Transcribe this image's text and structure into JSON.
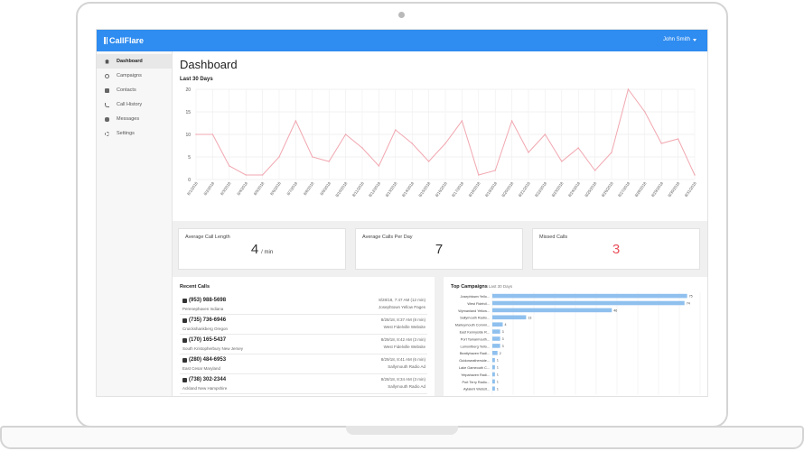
{
  "app": {
    "brand": "CallFlare",
    "user": "John Smith"
  },
  "sidebar": {
    "items": [
      {
        "label": "Dashboard",
        "icon": "home-icon",
        "active": true
      },
      {
        "label": "Campaigns",
        "icon": "campaigns-icon"
      },
      {
        "label": "Contacts",
        "icon": "contacts-icon"
      },
      {
        "label": "Call History",
        "icon": "phone-icon"
      },
      {
        "label": "Messages",
        "icon": "messages-icon"
      },
      {
        "label": "Settings",
        "icon": "gear-icon"
      }
    ]
  },
  "page": {
    "title": "Dashboard"
  },
  "stats": [
    {
      "label": "Average Call Length",
      "value": "4",
      "unit": "/ min"
    },
    {
      "label": "Average Calls Per Day",
      "value": "7",
      "unit": ""
    },
    {
      "label": "Missed Calls",
      "value": "3",
      "unit": ""
    }
  ],
  "recent_calls": {
    "title": "Recent Calls",
    "rows": [
      {
        "number": "(953) 988-5698",
        "location": "Perenephaven Indiana",
        "date": "8/28/18, 7:47 AM (12 min)",
        "source": "Josephtown Yellow Pages"
      },
      {
        "number": "(735) 736-6946",
        "location": "Cruickshankberg Oregon",
        "date": "8/28/18, 8:37 AM (8 min)",
        "source": "West Fidelville Website"
      },
      {
        "number": "(170) 165-5437",
        "location": "South Kristopherbury New Jersey",
        "date": "8/29/18, 8:42 AM (3 min)",
        "source": "West Fidelville Website"
      },
      {
        "number": "(280) 484-6953",
        "location": "East Cesar Maryland",
        "date": "8/29/18, 8:41 AM (6 min)",
        "source": "Sallymouth Radio Ad"
      },
      {
        "number": "(738) 302-2344",
        "location": "Ackland New Hampshire",
        "date": "8/28/18, 8:34 AM (3 min)",
        "source": "Sallymouth Radio Ad"
      }
    ]
  },
  "top_campaigns": {
    "title": "Top Campaigns",
    "subtitle": "Last 30 Days"
  },
  "colors": {
    "accent": "#2f8cf0",
    "line": "#f1a7b0",
    "bar": "#8fc0ee",
    "missed": "#e8505b"
  },
  "chart_data": [
    {
      "type": "line",
      "title": "Last 30 Days",
      "ylim": [
        0,
        20
      ],
      "yticks": [
        0,
        5,
        10,
        15,
        20
      ],
      "grid": true,
      "x": [
        "8/1/2018",
        "8/2/2018",
        "8/3/2018",
        "8/4/2018",
        "8/5/2018",
        "8/6/2018",
        "8/7/2018",
        "8/8/2018",
        "8/9/2018",
        "8/10/2018",
        "8/11/2018",
        "8/12/2018",
        "8/13/2018",
        "8/14/2018",
        "8/15/2018",
        "8/16/2018",
        "8/17/2018",
        "8/18/2018",
        "8/19/2018",
        "8/20/2018",
        "8/21/2018",
        "8/22/2018",
        "8/23/2018",
        "8/24/2018",
        "8/25/2018",
        "8/26/2018",
        "8/27/2018",
        "8/28/2018",
        "8/29/2018",
        "8/30/2018",
        "8/31/2018"
      ],
      "series": [
        {
          "values": [
            10,
            10,
            3,
            1,
            1,
            5,
            13,
            5,
            4,
            10,
            7,
            3,
            11,
            8,
            4,
            8,
            13,
            1,
            2,
            13,
            6,
            10,
            4,
            7,
            2,
            6,
            20,
            15,
            8,
            9,
            1
          ]
        }
      ]
    },
    {
      "type": "bar",
      "orientation": "horizontal",
      "title": "Top Campaigns",
      "subtitle": "Last 30 Days",
      "categories": [
        "Josephtown Yello...",
        "West Fidelvil...",
        "Wymanland Yellow...",
        "Sallymouth Radio...",
        "Marleymouth Commi...",
        "East Kennyside R...",
        "Port Tamarmouth...",
        "Lamontberg Yello...",
        "Beattyhaven Radi...",
        "Guidoweatherside...",
        "Lake Gameouth C...",
        "Yelpahaven Radi...",
        "Port Terry Radio...",
        "Aylakmi Websit..."
      ],
      "values": [
        75,
        74,
        46,
        13,
        4,
        3,
        3,
        3,
        2,
        1,
        1,
        1,
        1,
        1
      ],
      "xlim": [
        0,
        80
      ],
      "data_labels": [
        "75",
        "74",
        "46",
        "13",
        "4",
        "3",
        "3",
        "3",
        "2",
        "1",
        "1",
        "1",
        "1",
        "1"
      ]
    }
  ]
}
